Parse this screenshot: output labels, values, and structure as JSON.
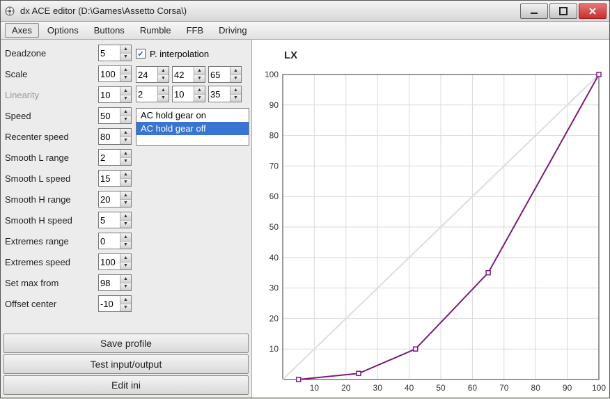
{
  "window": {
    "title": "dx ACE editor (D:\\Games\\Assetto Corsa\\)"
  },
  "menu": {
    "items": [
      "Axes",
      "Options",
      "Buttons",
      "Rumble",
      "FFB",
      "Driving"
    ],
    "active_index": 0
  },
  "params": [
    {
      "label": "Deadzone",
      "value": "5",
      "disabled": false
    },
    {
      "label": "Scale",
      "value": "100",
      "disabled": false
    },
    {
      "label": "Linearity",
      "value": "10",
      "disabled": true
    },
    {
      "label": "Speed",
      "value": "50",
      "disabled": false
    },
    {
      "label": "Recenter speed",
      "value": "80",
      "disabled": false
    },
    {
      "label": "Smooth L range",
      "value": "2",
      "disabled": false
    },
    {
      "label": "Smooth L speed",
      "value": "15",
      "disabled": false
    },
    {
      "label": "Smooth H range",
      "value": "20",
      "disabled": false
    },
    {
      "label": "Smooth H speed",
      "value": "5",
      "disabled": false
    },
    {
      "label": "Extremes range",
      "value": "0",
      "disabled": false
    },
    {
      "label": "Extremes speed",
      "value": "100",
      "disabled": false
    },
    {
      "label": "Set max from",
      "value": "98",
      "disabled": false
    },
    {
      "label": "Offset center",
      "value": "-10",
      "disabled": false
    }
  ],
  "interp": {
    "checkbox_label": "P. interpolation",
    "checked": true,
    "row1": [
      "24",
      "42",
      "65"
    ],
    "row2": [
      "2",
      "10",
      "35"
    ]
  },
  "gear_list": {
    "items": [
      "AC hold gear on",
      "AC hold gear off"
    ],
    "selected_index": 1
  },
  "buttons": {
    "save": "Save profile",
    "test": "Test input/output",
    "edit": "Edit ini"
  },
  "chart_data": {
    "type": "line",
    "title": "LX",
    "xlabel": "",
    "ylabel": "",
    "xlim": [
      0,
      100
    ],
    "ylim": [
      0,
      100
    ],
    "xticks": [
      10,
      20,
      30,
      40,
      50,
      60,
      70,
      80,
      90,
      100
    ],
    "yticks": [
      10,
      20,
      30,
      40,
      50,
      60,
      70,
      80,
      90,
      100
    ],
    "diagonal": true,
    "series": [
      {
        "name": "LX",
        "color": "#7b1a7b",
        "x": [
          5,
          24,
          42,
          65,
          100
        ],
        "y": [
          0,
          2,
          10,
          35,
          100
        ]
      }
    ]
  }
}
